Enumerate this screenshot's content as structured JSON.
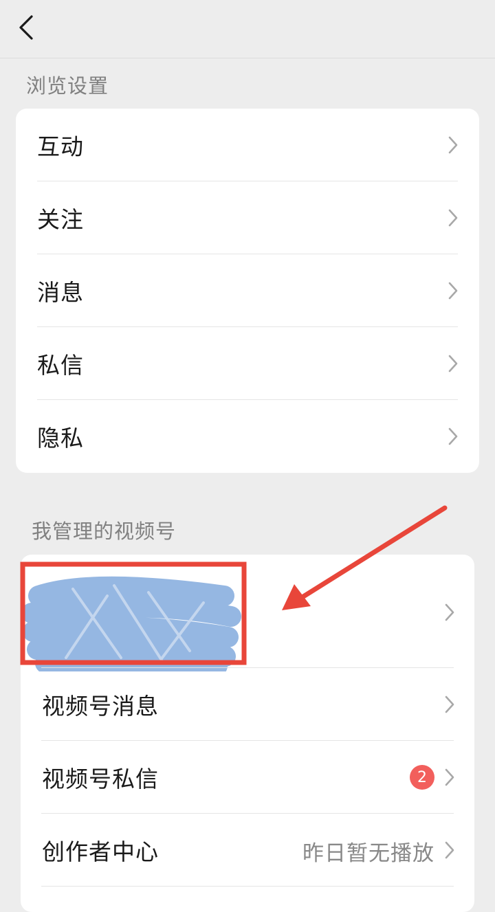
{
  "browse_section": {
    "title": "浏览设置",
    "items": [
      {
        "label": "互动"
      },
      {
        "label": "关注"
      },
      {
        "label": "消息"
      },
      {
        "label": "私信"
      },
      {
        "label": "隐私"
      }
    ]
  },
  "channels_section": {
    "title": "我管理的视频号",
    "account_row": {
      "redacted": true
    },
    "items": [
      {
        "label": "视频号消息",
        "badge": "",
        "value": ""
      },
      {
        "label": "视频号私信",
        "badge": "2",
        "value": ""
      },
      {
        "label": "创作者中心",
        "badge": "",
        "value": "昨日暂无播放"
      }
    ]
  },
  "colors": {
    "background": "#ededed",
    "card": "#ffffff",
    "badge": "#f25f5c",
    "annotation": "#e8463a",
    "scribble": "#8fb3e0"
  },
  "icons": {
    "back": "chevron-left-icon",
    "row_arrow": "chevron-right-icon"
  }
}
